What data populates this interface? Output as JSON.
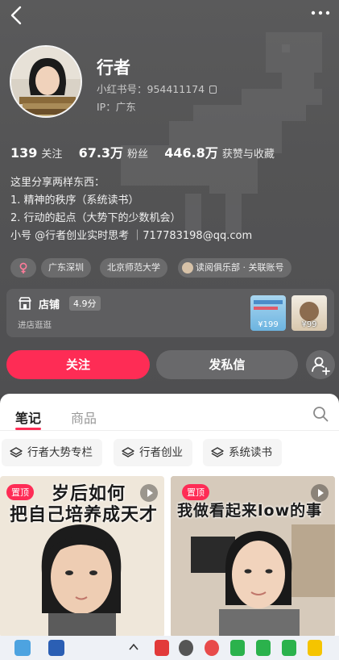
{
  "profile": {
    "name": "行者",
    "id_label": "小红书号：954411174",
    "ip_label": "IP：广东"
  },
  "stats": [
    {
      "value": "139",
      "label": "关注"
    },
    {
      "value": "67.3万",
      "label": "粉丝"
    },
    {
      "value": "446.8万",
      "label": "获赞与收藏"
    }
  ],
  "bio": [
    "这里分享两样东西：",
    "1. 精神的秩序（系统读书）",
    "2. 行动的起点（大势下的少数机会）",
    "小号 @行者创业实时思考  ｜717783198@qq.com"
  ],
  "tags": [
    "广东深圳",
    "北京师范大学",
    "读阅俱乐部 · 关联账号"
  ],
  "store": {
    "title": "店铺",
    "rating": "4.9分",
    "subtitle": "进店逛逛",
    "products": [
      {
        "price": "¥199"
      },
      {
        "price": "¥99"
      }
    ]
  },
  "actions": {
    "follow": "关注",
    "message": "发私信"
  },
  "tabs": [
    "笔记",
    "商品"
  ],
  "collections": [
    "行者大势专栏",
    "行者创业",
    "系统读书"
  ],
  "notes": [
    {
      "pin": "置顶",
      "caption_line1": "岁后如何",
      "caption_line2": "把自己培养成天才"
    },
    {
      "pin": "置顶",
      "caption_line1": "我做看起来low的事"
    }
  ],
  "colors": {
    "accent": "#fe2c55",
    "header_bg": "#545455"
  },
  "icons": [
    "back-icon",
    "more-icon",
    "copy-icon",
    "female-icon",
    "store-icon",
    "add-friend-icon",
    "search-icon",
    "layers-icon",
    "play-icon"
  ]
}
